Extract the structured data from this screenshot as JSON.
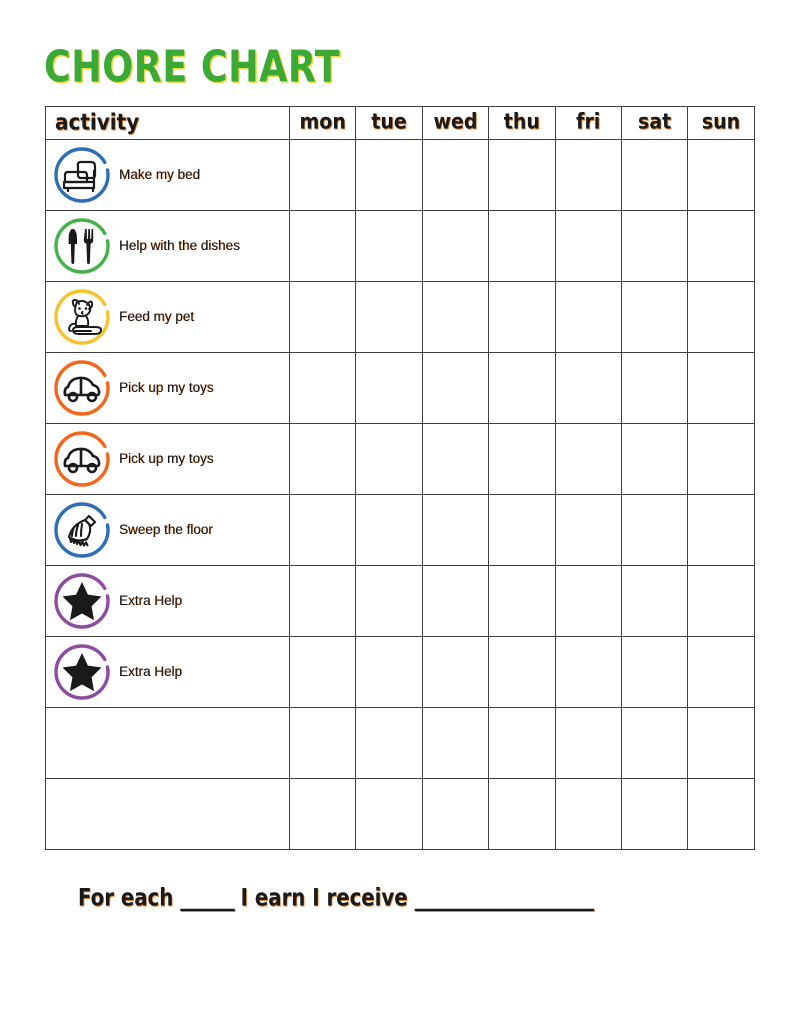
{
  "page": {
    "title": "CHORE CHART",
    "title_color": "#3aaa35",
    "title_shadow_color": "#f0d84a"
  },
  "table": {
    "activity_header": "activity",
    "day_headers": [
      "mon",
      "tue",
      "wed",
      "thu",
      "fri",
      "sat",
      "sun"
    ],
    "rows": [
      {
        "label": "Make my bed",
        "icon": "bed-icon",
        "icon_color": "#2f6eb5"
      },
      {
        "label": "Help with the dishes",
        "icon": "cutlery-icon",
        "icon_color": "#44b149"
      },
      {
        "label": "Feed my pet",
        "icon": "dog-icon",
        "icon_color": "#f5c32c"
      },
      {
        "label": "Pick up my toys",
        "icon": "car-icon",
        "icon_color": "#f4661b"
      },
      {
        "label": "Pick up my toys",
        "icon": "car-icon",
        "icon_color": "#f4661b"
      },
      {
        "label": "Sweep the floor",
        "icon": "broom-icon",
        "icon_color": "#2f6eb5"
      },
      {
        "label": "Extra Help",
        "icon": "star-icon",
        "icon_color": "#8e4ca0"
      },
      {
        "label": "Extra Help",
        "icon": "star-icon",
        "icon_color": "#8e4ca0"
      },
      {
        "label": "",
        "icon": "",
        "icon_color": ""
      },
      {
        "label": "",
        "icon": "",
        "icon_color": ""
      }
    ]
  },
  "footer": {
    "text_before": "For each",
    "blank_short": "______",
    "text_middle": "I earn I receive",
    "blank_long": "____________________"
  }
}
